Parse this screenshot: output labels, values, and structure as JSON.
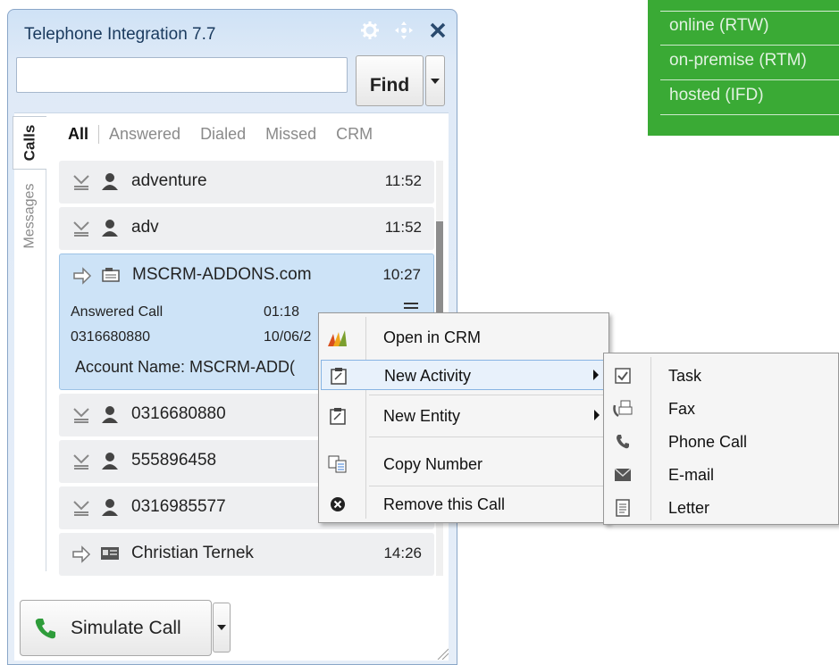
{
  "deployment": {
    "items": [
      "online (RTW)",
      "on-premise (RTM)",
      "hosted (IFD)"
    ]
  },
  "window": {
    "title": "Telephone Integration 7.7"
  },
  "search": {
    "value": "",
    "find_label": "Find"
  },
  "side_tabs": [
    "Calls",
    "Messages"
  ],
  "filters": [
    "All",
    "Answered",
    "Dialed",
    "Missed",
    "CRM"
  ],
  "calls": [
    {
      "name": "adventure",
      "time": "11:52"
    },
    {
      "name": "adv",
      "time": "11:52"
    },
    {
      "name": "MSCRM-ADDONS.com",
      "time": "10:27"
    },
    {
      "name": "0316680880",
      "time": ""
    },
    {
      "name": "555896458",
      "time": ""
    },
    {
      "name": "0316985577",
      "time": ""
    },
    {
      "name": "Christian Ternek",
      "time": "14:26"
    }
  ],
  "expanded_call": {
    "status": "Answered Call",
    "duration": "01:18",
    "number": "0316680880",
    "date": "10/06/2",
    "account": "Account Name: MSCRM-ADD("
  },
  "simulate_label": "Simulate Call",
  "context_menu": {
    "items": [
      "Open in CRM",
      "New Activity",
      "New Entity",
      "Copy Number",
      "Remove this Call"
    ]
  },
  "submenu": {
    "items": [
      "Task",
      "Fax",
      "Phone Call",
      "E-mail",
      "Letter"
    ]
  },
  "colors": {
    "badge_green": "#3aaa35",
    "highlight_blue": "#cde3f7"
  }
}
